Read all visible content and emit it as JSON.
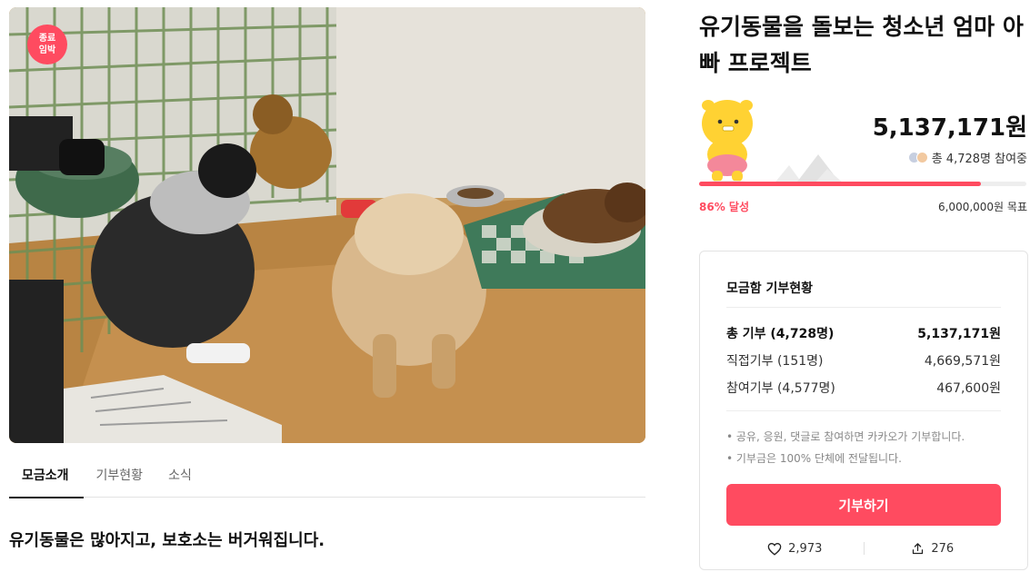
{
  "campaign": {
    "badge_line1": "종료",
    "badge_line2": "임박",
    "title": "유기동물을 돌보는 청소년 엄마 아빠 프로젝트"
  },
  "tabs": [
    {
      "label": "모금소개",
      "active": true
    },
    {
      "label": "기부현황",
      "active": false
    },
    {
      "label": "소식",
      "active": false
    }
  ],
  "intro_heading": "유기동물은 많아지고, 보호소는 버거워집니다.",
  "funding": {
    "amount": "5,137,171원",
    "participants": "총 4,728명 참여중",
    "progress_percent": 86,
    "percent_label": "86% 달성",
    "goal": "6,000,000원 목표"
  },
  "summary": {
    "title": "모금함 기부현황",
    "rows": [
      {
        "label": "총 기부 (4,728명)",
        "value": "5,137,171원"
      },
      {
        "label": "직접기부 (151명)",
        "value": "4,669,571원"
      },
      {
        "label": "참여기부 (4,577명)",
        "value": "467,600원"
      }
    ],
    "notes": [
      "• 공유, 응원, 댓글로 참여하면 카카오가 기부합니다.",
      "• 기부금은 100% 단체에 전달됩니다."
    ],
    "donate_label": "기부하기",
    "likes": "2,973",
    "shares": "276"
  },
  "colors": {
    "accent": "#ff4b60",
    "text": "#222222",
    "muted": "#888888"
  },
  "icons": {
    "like": "heart-icon",
    "share": "share-icon"
  }
}
